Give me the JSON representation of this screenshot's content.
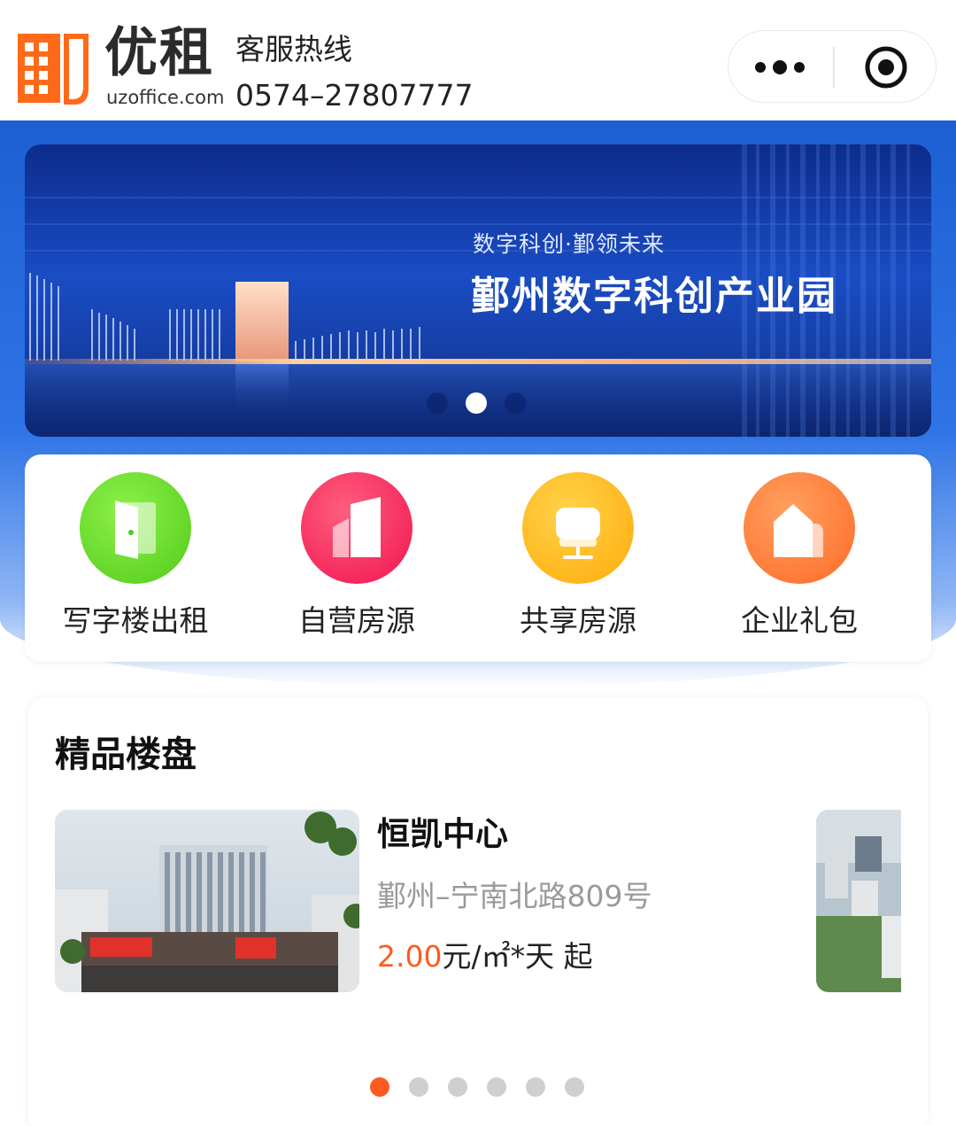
{
  "header": {
    "logo_text": "优租",
    "logo_domain": "uzoffice.com",
    "hotline_label": "客服热线",
    "hotline_number": "0574–27807777",
    "capsule": {
      "more_icon": "more-dots-icon",
      "close_icon": "target-circle-icon"
    }
  },
  "banner": {
    "subtitle": "数字科创·鄞领未来",
    "title": "鄞州数字科创产业园",
    "slides_total": 3,
    "active_slide": 2
  },
  "menu": {
    "items": [
      {
        "label": "写字楼出租",
        "icon": "door-icon",
        "color": "#5bd424"
      },
      {
        "label": "自营房源",
        "icon": "building-icon",
        "color": "#f2285a"
      },
      {
        "label": "共享房源",
        "icon": "chair-icon",
        "color": "#ffb514"
      },
      {
        "label": "企业礼包",
        "icon": "house-gift-icon",
        "color": "#ff7a2b"
      }
    ]
  },
  "featured": {
    "title": "精品楼盘",
    "property": {
      "name": "恒凯中心",
      "address": "鄞州–宁南北路809号",
      "price_value": "2.00",
      "price_unit": "元/㎡*天 起"
    },
    "slides_total": 6,
    "active_slide": 1
  },
  "colors": {
    "brand_orange": "#ff5a1f",
    "banner_blue": "#1c5fd3"
  }
}
